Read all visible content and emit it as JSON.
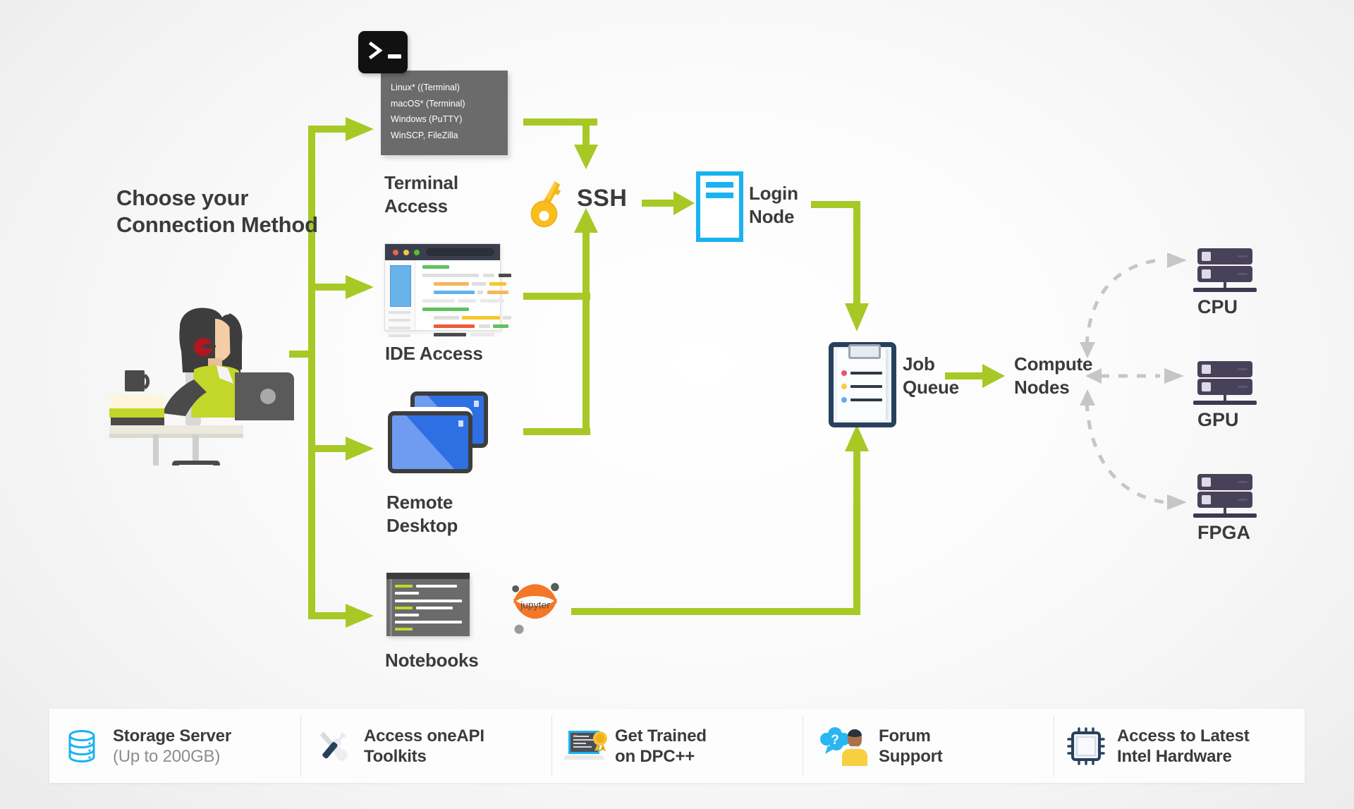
{
  "headline": "Choose your\nConnection\nMethod",
  "colors": {
    "green": "#a8c825",
    "cyan": "#18b3f0",
    "gold": "#f5b81c",
    "navy": "#27405c",
    "server": "#474259",
    "gray_panel": "#6b6b6b",
    "text": "#3b3b3b"
  },
  "terminal": {
    "caption": "Terminal\nAccess",
    "items": [
      "Linux* ((Terminal)",
      "macOS* (Terminal)",
      "Windows (PuTTY)",
      "WinSCP, FileZilla"
    ]
  },
  "ide": {
    "caption": "IDE Access"
  },
  "remote_desktop": {
    "caption": "Remote\nDesktop"
  },
  "notebooks": {
    "caption": "Notebooks",
    "logo": "jupyter"
  },
  "ssh": {
    "label": "SSH"
  },
  "login_node": {
    "label": "Login\nNode"
  },
  "job_queue": {
    "label": "Job\nQueue"
  },
  "compute_nodes": {
    "label": "Compute\nNodes"
  },
  "hardware": [
    {
      "label": "CPU"
    },
    {
      "label": "GPU"
    },
    {
      "label": "FPGA"
    }
  ],
  "bottom_bar": [
    {
      "title": "Storage Server",
      "sub": "(Up to 200GB)",
      "icon": "database-icon"
    },
    {
      "title": "Access oneAPI\nToolkits",
      "sub": "",
      "icon": "tools-icon"
    },
    {
      "title": "Get Trained\non DPC++",
      "sub": "",
      "icon": "laptop-medal-icon"
    },
    {
      "title": "Forum\nSupport",
      "sub": "",
      "icon": "person-question-icon"
    },
    {
      "title": "Access to Latest\nIntel Hardware",
      "sub": "",
      "icon": "chip-icon"
    }
  ],
  "chart_data": {
    "type": "diagram",
    "title": "Choose your Connection Method",
    "nodes": [
      "Terminal Access",
      "IDE Access",
      "Remote Desktop",
      "Notebooks",
      "SSH",
      "Login Node",
      "Job Queue",
      "Compute Nodes",
      "CPU",
      "GPU",
      "FPGA"
    ],
    "edges": [
      {
        "from": "User",
        "to": "Terminal Access",
        "style": "solid-green"
      },
      {
        "from": "User",
        "to": "IDE Access",
        "style": "solid-green"
      },
      {
        "from": "User",
        "to": "Remote Desktop",
        "style": "solid-green"
      },
      {
        "from": "User",
        "to": "Notebooks",
        "style": "solid-green"
      },
      {
        "from": "Terminal Access",
        "to": "SSH",
        "style": "solid-green"
      },
      {
        "from": "IDE Access",
        "to": "SSH",
        "style": "solid-green"
      },
      {
        "from": "Remote Desktop",
        "to": "SSH",
        "style": "solid-green"
      },
      {
        "from": "SSH",
        "to": "Login Node",
        "style": "solid-green"
      },
      {
        "from": "Login Node",
        "to": "Job Queue",
        "style": "solid-green"
      },
      {
        "from": "Notebooks",
        "to": "Job Queue",
        "style": "solid-green"
      },
      {
        "from": "Job Queue",
        "to": "Compute Nodes",
        "style": "solid-green"
      },
      {
        "from": "Compute Nodes",
        "to": "CPU",
        "style": "dashed-gray-bidirectional"
      },
      {
        "from": "Compute Nodes",
        "to": "GPU",
        "style": "dashed-gray-bidirectional"
      },
      {
        "from": "Compute Nodes",
        "to": "FPGA",
        "style": "dashed-gray-bidirectional"
      }
    ]
  }
}
